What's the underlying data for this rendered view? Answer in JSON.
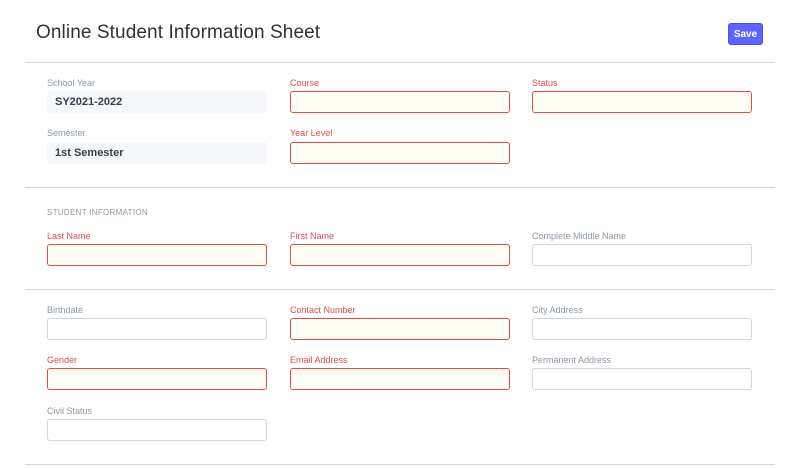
{
  "header": {
    "title": "Online Student Information Sheet",
    "save_label": "Save"
  },
  "enrollment": {
    "school_year": {
      "label": "School Year",
      "value": "SY2021-2022"
    },
    "semester": {
      "label": "Semester",
      "value": "1st Semester"
    },
    "course": {
      "label": "Course",
      "value": ""
    },
    "year_level": {
      "label": "Year Level",
      "value": ""
    },
    "status": {
      "label": "Status",
      "value": ""
    }
  },
  "student_info": {
    "heading": "STUDENT INFORMATION",
    "last_name": {
      "label": "Last Name",
      "value": ""
    },
    "first_name": {
      "label": "First Name",
      "value": ""
    },
    "middle_name": {
      "label": "Complete Middle Name",
      "value": ""
    }
  },
  "personal": {
    "birthdate": {
      "label": "Birthdate",
      "value": ""
    },
    "gender": {
      "label": "Gender",
      "value": ""
    },
    "civil_status": {
      "label": "Civil Status",
      "value": ""
    },
    "contact_number": {
      "label": "Contact Number",
      "value": ""
    },
    "email_address": {
      "label": "Email Address",
      "value": ""
    },
    "city_address": {
      "label": "City Address",
      "value": ""
    },
    "permanent_address": {
      "label": "Permanent Address",
      "value": ""
    }
  },
  "colors": {
    "primary": "#5e64ff",
    "required": "#e24c4c",
    "required_bg": "#fffdf4",
    "border": "#d1d8dd",
    "muted_text": "#8d99a6"
  }
}
